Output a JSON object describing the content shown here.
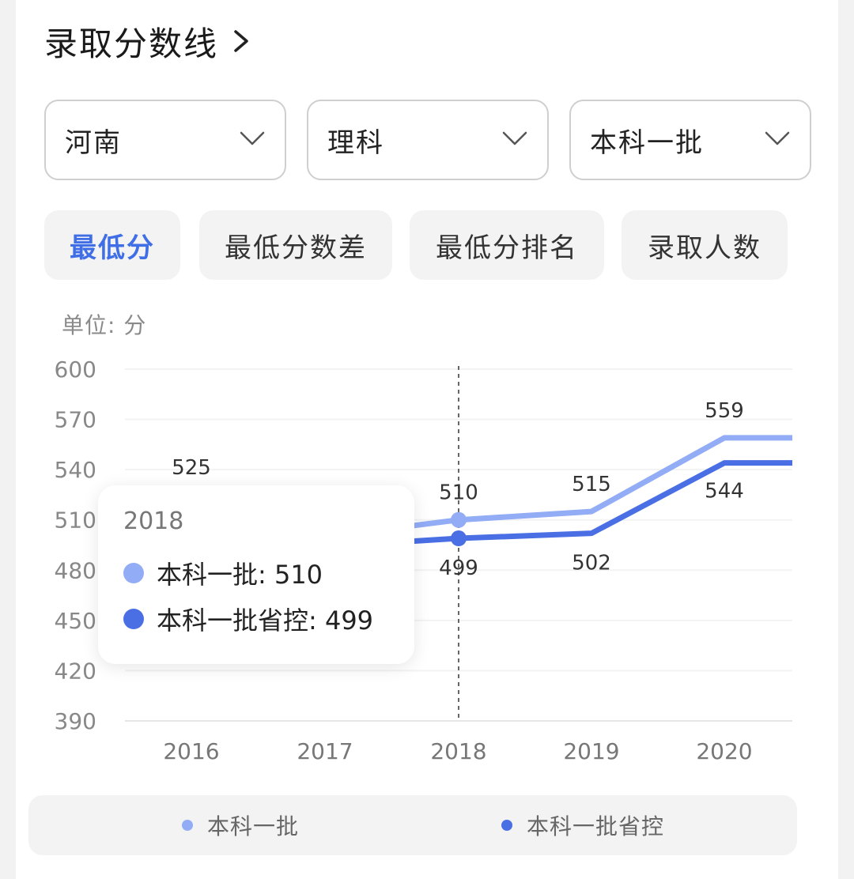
{
  "header": {
    "title": "录取分数线"
  },
  "filters": [
    {
      "value": "河南"
    },
    {
      "value": "理科"
    },
    {
      "value": "本科一批"
    }
  ],
  "tabs": [
    {
      "label": "最低分",
      "active": true
    },
    {
      "label": "最低分数差",
      "active": false
    },
    {
      "label": "最低分排名",
      "active": false
    },
    {
      "label": "录取人数",
      "active": false
    }
  ],
  "unit_label": "单位: 分",
  "tooltip": {
    "year": "2018",
    "rows": [
      {
        "text": "本科一批: 510"
      },
      {
        "text": "本科一批省控: 499"
      }
    ]
  },
  "legend": [
    {
      "label": "本科一批"
    },
    {
      "label": "本科一批省控"
    }
  ],
  "colors": {
    "series1": "#92acf5",
    "series2": "#4a6fe5",
    "accent": "#3f6ee6"
  },
  "chart_data": {
    "type": "line",
    "x": [
      "2016",
      "2017",
      "2018",
      "2019",
      "2020"
    ],
    "ylim": [
      390,
      600
    ],
    "yticks": [
      600,
      570,
      540,
      510,
      480,
      450,
      420,
      390
    ],
    "series": [
      {
        "name": "本科一批",
        "values": [
          525,
          500,
          510,
          515,
          559
        ]
      },
      {
        "name": "本科一批省控",
        "values": [
          496,
          494,
          499,
          502,
          544
        ]
      }
    ],
    "highlight_x": "2018",
    "data_labels": {
      "本科一批": [
        "525",
        null,
        "510",
        "515",
        "559"
      ],
      "本科一批省控": [
        null,
        null,
        "499",
        "502",
        "544"
      ]
    },
    "grid": true,
    "legend_position": "bottom"
  }
}
